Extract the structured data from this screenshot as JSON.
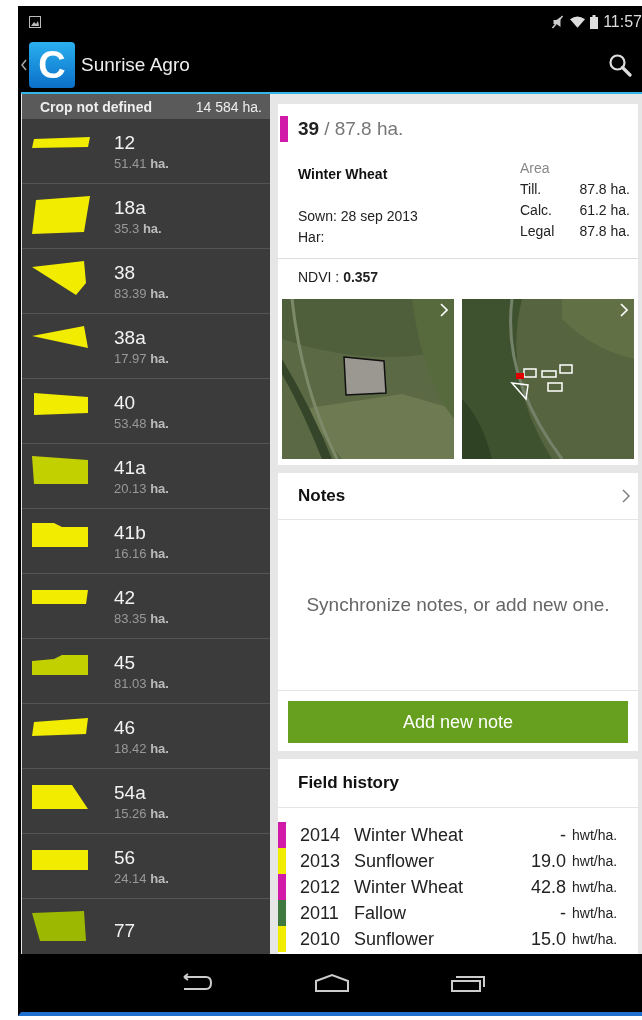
{
  "status_bar": {
    "time": "11:57"
  },
  "action_bar": {
    "logo_letter": "C",
    "title": "Sunrise Agro"
  },
  "crop_group": {
    "name": "Crop not defined",
    "area": "14  584 ha."
  },
  "fields": [
    {
      "name": "12",
      "area": "51.41",
      "unit": "ha.",
      "color": "#f2ec00"
    },
    {
      "name": "18a",
      "area": "35.3",
      "unit": "ha.",
      "color": "#f2ec00"
    },
    {
      "name": "38",
      "area": "83.39",
      "unit": "ha.",
      "color": "#f2ec00"
    },
    {
      "name": "38a",
      "area": "17.97",
      "unit": "ha.",
      "color": "#f2ec00"
    },
    {
      "name": "40",
      "area": "53.48",
      "unit": "ha.",
      "color": "#f2ec00"
    },
    {
      "name": "41a",
      "area": "20.13",
      "unit": "ha.",
      "color": "#c2d000"
    },
    {
      "name": "41b",
      "area": "16.16",
      "unit": "ha.",
      "color": "#f2ec00"
    },
    {
      "name": "42",
      "area": "83.35",
      "unit": "ha.",
      "color": "#f2ec00"
    },
    {
      "name": "45",
      "area": "81.03",
      "unit": "ha.",
      "color": "#c2d000"
    },
    {
      "name": "46",
      "area": "18.42",
      "unit": "ha.",
      "color": "#f2ec00"
    },
    {
      "name": "54a",
      "area": "15.26",
      "unit": "ha.",
      "color": "#f2ec00"
    },
    {
      "name": "56",
      "area": "24.14",
      "unit": "ha.",
      "color": "#f2ec00"
    },
    {
      "name": "77",
      "color": "#9cb800"
    }
  ],
  "field_detail": {
    "number": "39",
    "area": "/ 87.8 ha.",
    "color": "#d21aa8",
    "crop": "Winter Wheat",
    "sown": "Sown: 28 sep 2013",
    "harvest": "Har:",
    "area_title": "Area",
    "areas": [
      {
        "label": "Till.",
        "value": "87.8 ha."
      },
      {
        "label": "Calc.",
        "value": "61.2 ha."
      },
      {
        "label": "Legal",
        "value": "87.8 ha."
      }
    ],
    "ndvi_label": "NDVI :",
    "ndvi_value": "0.357"
  },
  "notes": {
    "title": "Notes",
    "empty_text": "Synchronize notes, or add new one.",
    "button": "Add new note"
  },
  "field_history": {
    "title": "Field history",
    "rows": [
      {
        "year": "2014",
        "crop": "Winter Wheat",
        "yield": "-",
        "unit": "hwt/ha.",
        "color": "#d21aa8"
      },
      {
        "year": "2013",
        "crop": "Sunflower",
        "yield": "19.0",
        "unit": "hwt/ha.",
        "color": "#f2ec00"
      },
      {
        "year": "2012",
        "crop": "Winter Wheat",
        "yield": "42.8",
        "unit": "hwt/ha.",
        "color": "#d21aa8"
      },
      {
        "year": "2011",
        "crop": "Fallow",
        "yield": "-",
        "unit": "hwt/ha.",
        "color": "#3e7a3e"
      },
      {
        "year": "2010",
        "crop": "Sunflower",
        "yield": "15.0",
        "unit": "hwt/ha.",
        "color": "#f2ec00"
      }
    ]
  }
}
